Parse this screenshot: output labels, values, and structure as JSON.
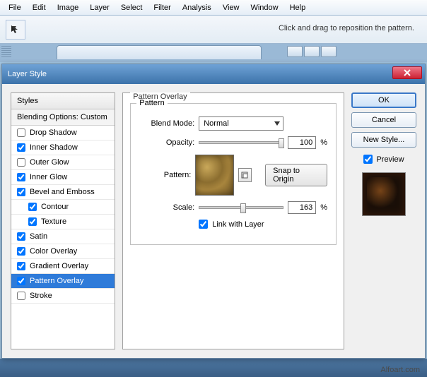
{
  "menu": {
    "items": [
      "File",
      "Edit",
      "Image",
      "Layer",
      "Select",
      "Filter",
      "Analysis",
      "View",
      "Window",
      "Help"
    ]
  },
  "toolbar": {
    "hint": "Click and drag to reposition the pattern."
  },
  "dialog": {
    "title": "Layer Style",
    "left": {
      "header": "Styles",
      "sub": "Blending Options: Custom",
      "items": [
        {
          "label": "Drop Shadow",
          "checked": false
        },
        {
          "label": "Inner Shadow",
          "checked": true
        },
        {
          "label": "Outer Glow",
          "checked": false
        },
        {
          "label": "Inner Glow",
          "checked": true
        },
        {
          "label": "Bevel and Emboss",
          "checked": true
        },
        {
          "label": "Contour",
          "checked": true,
          "indent": true
        },
        {
          "label": "Texture",
          "checked": true,
          "indent": true
        },
        {
          "label": "Satin",
          "checked": true
        },
        {
          "label": "Color Overlay",
          "checked": true
        },
        {
          "label": "Gradient Overlay",
          "checked": true
        },
        {
          "label": "Pattern Overlay",
          "checked": true,
          "selected": true
        },
        {
          "label": "Stroke",
          "checked": false
        }
      ]
    },
    "center": {
      "title": "Pattern Overlay",
      "group": "Pattern",
      "blend_label": "Blend Mode:",
      "blend_value": "Normal",
      "opacity_label": "Opacity:",
      "opacity_value": "100",
      "pct": "%",
      "pattern_label": "Pattern:",
      "snap": "Snap to Origin",
      "scale_label": "Scale:",
      "scale_value": "163",
      "link": "Link with Layer"
    },
    "right": {
      "ok": "OK",
      "cancel": "Cancel",
      "newstyle": "New Style...",
      "preview": "Preview"
    }
  },
  "watermark": "Alfoart.com"
}
